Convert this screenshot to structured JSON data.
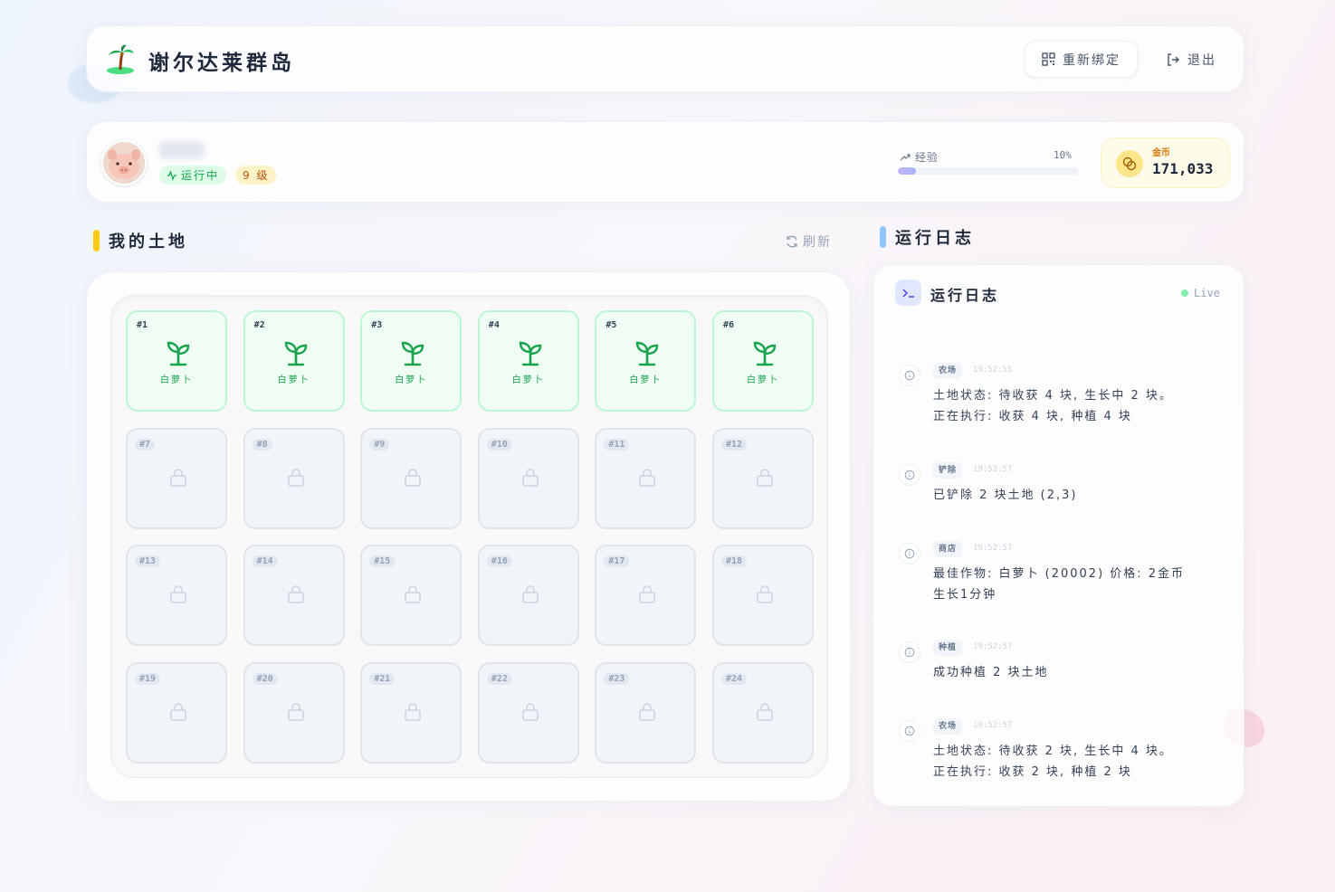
{
  "header": {
    "title": "谢尔达莱群岛",
    "rebind_label": "重新绑定",
    "logout_label": "退出"
  },
  "user": {
    "name": "",
    "status": "运行中",
    "level": "9 级",
    "exp_label": "经验",
    "exp_percent": "10%",
    "exp_value": 0.1,
    "gold_label": "金币",
    "gold_value": "171,033"
  },
  "land": {
    "title": "我的土地",
    "refresh_label": "刷新",
    "plots": [
      {
        "num": "#1",
        "crop": "白萝卜",
        "planted": true
      },
      {
        "num": "#2",
        "crop": "白萝卜",
        "planted": true
      },
      {
        "num": "#3",
        "crop": "白萝卜",
        "planted": true
      },
      {
        "num": "#4",
        "crop": "白萝卜",
        "planted": true
      },
      {
        "num": "#5",
        "crop": "白萝卜",
        "planted": true
      },
      {
        "num": "#6",
        "crop": "白萝卜",
        "planted": true
      },
      {
        "num": "#7",
        "crop": "",
        "planted": false
      },
      {
        "num": "#8",
        "crop": "",
        "planted": false
      },
      {
        "num": "#9",
        "crop": "",
        "planted": false
      },
      {
        "num": "#10",
        "crop": "",
        "planted": false
      },
      {
        "num": "#11",
        "crop": "",
        "planted": false
      },
      {
        "num": "#12",
        "crop": "",
        "planted": false
      },
      {
        "num": "#13",
        "crop": "",
        "planted": false
      },
      {
        "num": "#14",
        "crop": "",
        "planted": false
      },
      {
        "num": "#15",
        "crop": "",
        "planted": false
      },
      {
        "num": "#16",
        "crop": "",
        "planted": false
      },
      {
        "num": "#17",
        "crop": "",
        "planted": false
      },
      {
        "num": "#18",
        "crop": "",
        "planted": false
      },
      {
        "num": "#19",
        "crop": "",
        "planted": false
      },
      {
        "num": "#20",
        "crop": "",
        "planted": false
      },
      {
        "num": "#21",
        "crop": "",
        "planted": false
      },
      {
        "num": "#22",
        "crop": "",
        "planted": false
      },
      {
        "num": "#23",
        "crop": "",
        "planted": false
      },
      {
        "num": "#24",
        "crop": "",
        "planted": false
      }
    ]
  },
  "log": {
    "section_title": "运行日志",
    "panel_title": "运行日志",
    "live_label": "Live",
    "entries": [
      {
        "tag": "农场",
        "time": "19:52:55",
        "message": "土地状态: 待收获 4 块, 生长中 2 块。\n正在执行: 收获 4 块, 种植 4 块"
      },
      {
        "tag": "铲除",
        "time": "19:52:57",
        "message": "已铲除 2 块土地 (2,3)"
      },
      {
        "tag": "商店",
        "time": "19:52:57",
        "message": "最佳作物: 白萝卜 (20002) 价格: 2金币\n生长1分钟"
      },
      {
        "tag": "种植",
        "time": "19:52:57",
        "message": "成功种植 2 块土地"
      },
      {
        "tag": "农场",
        "time": "19:52:57",
        "message": "土地状态: 待收获 2 块, 生长中 4 块。\n正在执行: 收获 2 块, 种植 2 块"
      }
    ]
  },
  "colors": {
    "land_accent": "#facc15",
    "log_accent": "#93c5fd",
    "planted_bg": "#f0fdf4",
    "crop_green": "#16a34a"
  }
}
